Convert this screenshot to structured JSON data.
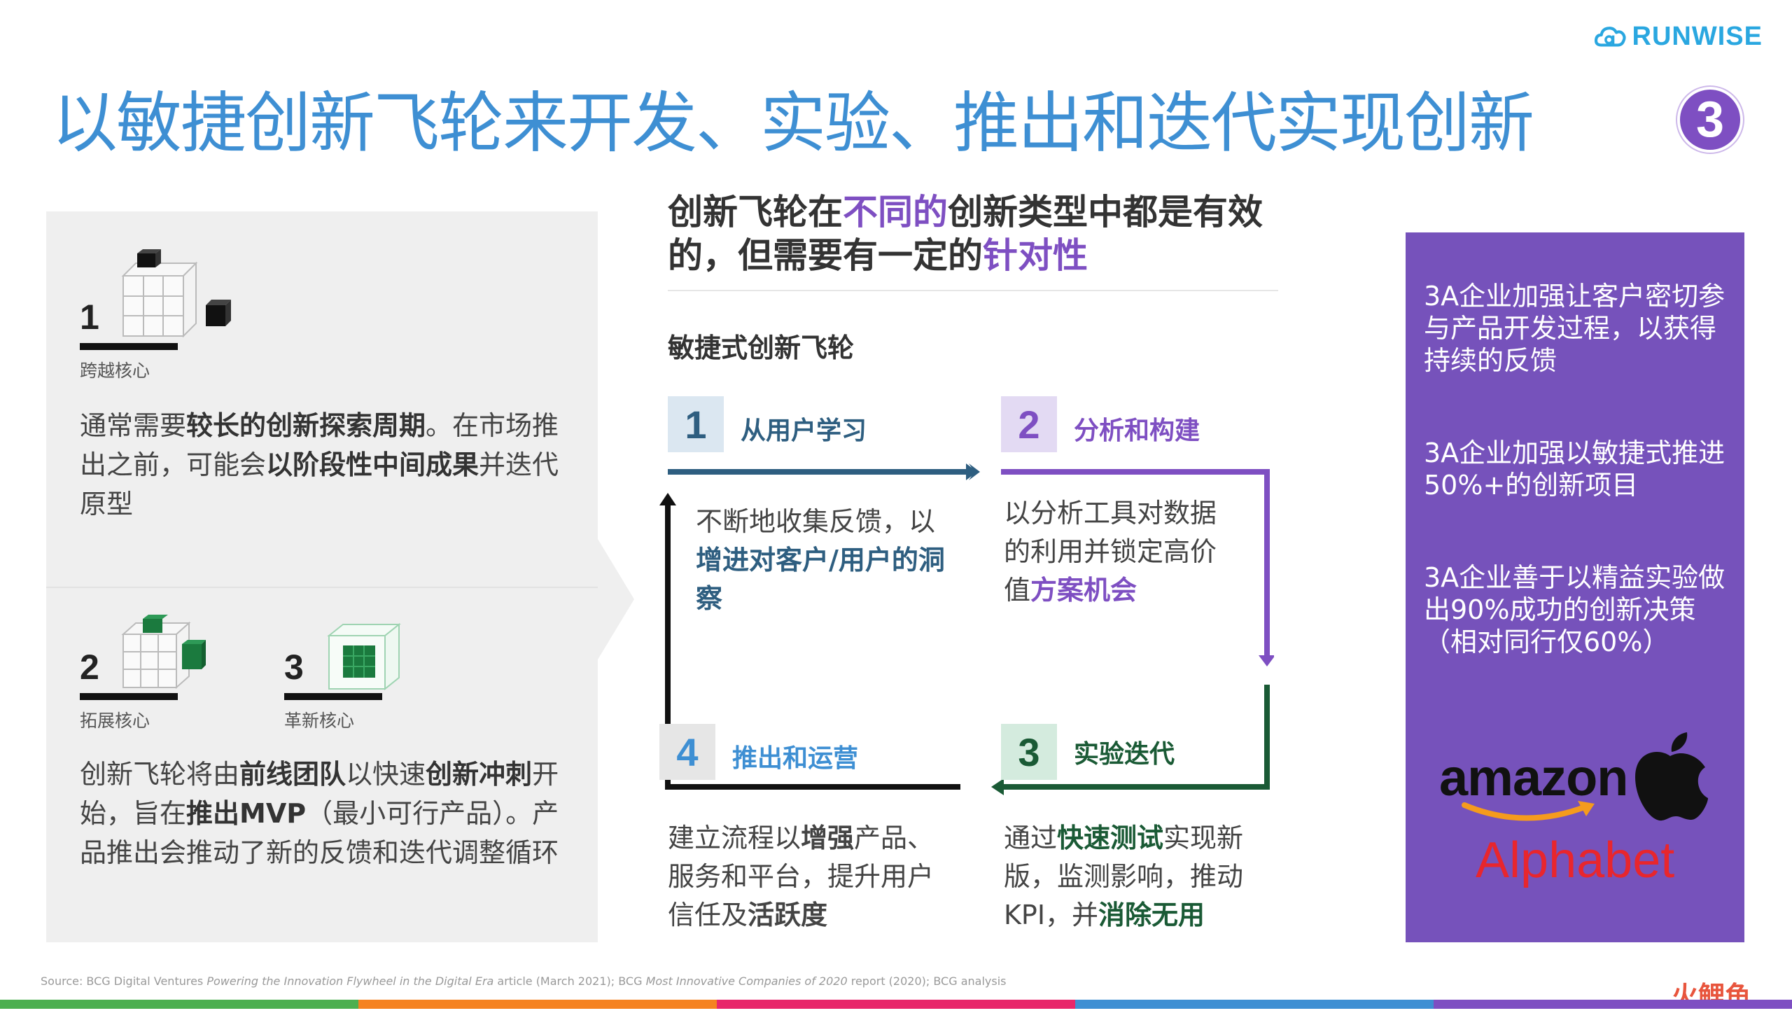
{
  "header": {
    "title": "以敏捷创新飞轮来开发、实验、推出和迭代实现创新",
    "logo_text": "RUNWISE",
    "page_badge": "3"
  },
  "left": {
    "cores": [
      {
        "num": "1",
        "label": "跨越核心"
      },
      {
        "num": "2",
        "label": "拓展核心"
      },
      {
        "num": "3",
        "label": "革新核心"
      }
    ],
    "text1": {
      "a": "通常需要",
      "b": "较长的创新探索周期",
      "c": "。在市场推出之前，可能会",
      "d": "以阶段性中间成果",
      "e": "并迭代原型"
    },
    "text2": {
      "a": "创新飞轮将由",
      "b": "前线团队",
      "c": "以快速",
      "d": "创新冲刺",
      "e": "开始，旨在",
      "f": "推出MVP",
      "g": "（最小可行产品）。产品推出会推动了新的反馈和迭代调整循环"
    }
  },
  "middle": {
    "heading": {
      "a": "创新飞轮在",
      "b": "不同的",
      "c": "创新类型中都是有效的，但需要有一定的",
      "d": "针对性"
    },
    "subheading": "敏捷式创新飞轮",
    "steps": [
      {
        "num": "1",
        "title": "从用户学习",
        "color": "#2e5e80",
        "bg": "#dbe7f1",
        "text": {
          "a": "不断地收集反馈，以",
          "b": "增进对客户/用户的洞察"
        }
      },
      {
        "num": "2",
        "title": "分析和构建",
        "color": "#7e4fc2",
        "bg": "#e3daf3",
        "text": {
          "a": "以分析工具对数据的利用并锁定高价值",
          "b": "方案机会"
        }
      },
      {
        "num": "3",
        "title": "实验迭代",
        "color": "#1a5a35",
        "bg": "#d4ebde",
        "text": {
          "a": "通过",
          "b": "快速测试",
          "c": "实现新版，监测影响，推动KPI，并",
          "d": "消除无用"
        }
      },
      {
        "num": "4",
        "title": "推出和运营",
        "color": "#3e8fd3",
        "bg": "#e6e6e6",
        "text": {
          "a": "建立流程以",
          "b": "增强",
          "c": "产品、服务和平台，提升用户信任及",
          "d": "活跃度"
        }
      }
    ]
  },
  "right": {
    "stats": [
      "3A企业加强让客户密切参与产品开发过程，以获得持续的反馈",
      "3A企业加强以敏捷式推进50%+的创新项目",
      "3A企业善于以精益实验做出90%成功的创新决策（相对同行仅60%）"
    ],
    "logos": {
      "amazon": "amazon",
      "alphabet": "Alphabet",
      "apple_icon": "apple-logo-icon"
    }
  },
  "footer": {
    "source": {
      "a": "Source: BCG Digital Ventures ",
      "b": "Powering the Innovation Flywheel in the Digital Era",
      "c": " article (March 2021); BCG ",
      "d": "Most Innovative Companies of 2020",
      "e": " report (2020); BCG analysis"
    },
    "watermark": "火鲤鱼"
  },
  "colors": {
    "title_blue": "#3e8fd3",
    "purple": "#7652bb",
    "badge_purple": "#7e4fc2",
    "step1_navy": "#2e5e80",
    "step3_green": "#1a5a35",
    "footer_bar": [
      "#4caf50",
      "#f58220",
      "#e8266a",
      "#3e8fd3",
      "#7e4fc2"
    ]
  }
}
